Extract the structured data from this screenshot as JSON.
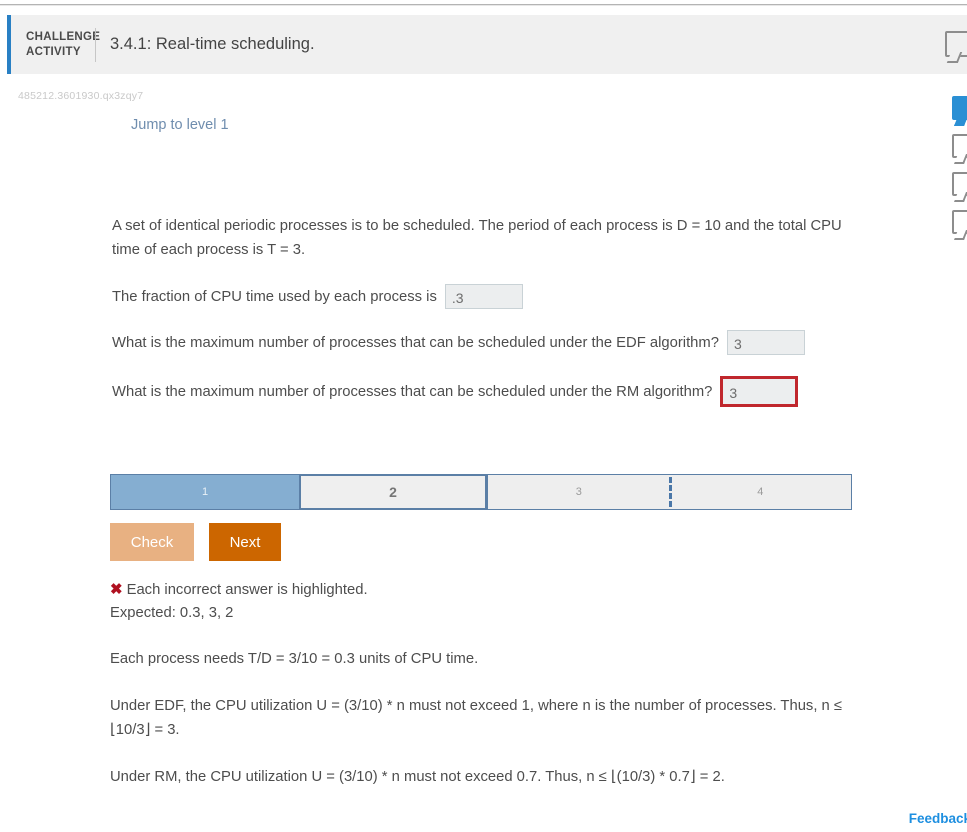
{
  "header": {
    "kicker_line1": "CHALLENGE",
    "kicker_line2": "ACTIVITY",
    "title": "3.4.1: Real-time scheduling.",
    "note_icon": "note-icon"
  },
  "activity_id": "485212.3601930.qx3zqy7",
  "jump_link": "Jump to level 1",
  "question": {
    "prompt": "A set of identical periodic processes is to be scheduled. The period of each process is D = 10 and the total CPU time of each process is T = 3.",
    "sub1_label": "The fraction of CPU time used by each process is",
    "sub1_value": ".3",
    "sub2_label": "What is the maximum number of processes that can be scheduled under the EDF algorithm?",
    "sub2_value": "3",
    "sub3_label": "What is the maximum number of processes that can be scheduled under the RM algorithm?",
    "sub3_value": "3"
  },
  "progress": {
    "steps": [
      {
        "label": "1",
        "state": "done"
      },
      {
        "label": "2",
        "state": "current"
      },
      {
        "label": "3",
        "state": "plain"
      },
      {
        "label": "4",
        "state": "plain"
      }
    ]
  },
  "buttons": {
    "check": "Check",
    "next": "Next"
  },
  "result": {
    "mark": "✖",
    "message": "Each incorrect answer is highlighted.",
    "expected": "Expected: 0.3, 3, 2"
  },
  "explanation": {
    "p1": "Each process needs T/D = 3/10 = 0.3 units of CPU time.",
    "p2": "Under EDF, the CPU utilization U = (3/10) * n must not exceed 1, where n is the number of processes. Thus, n ≤ ⌊10/3⌋ = 3.",
    "p3": "Under RM, the CPU utilization U = (3/10) * n must not exceed 0.7. Thus, n ≤ ⌊(10/3) * 0.7⌋ = 2."
  },
  "feedback": "Feedback",
  "colors": {
    "header_accent": "#2980c4",
    "header_bg": "#f0f0f0",
    "step_done": "#85aed1",
    "step_border": "#5b7fa6",
    "check_button": "#e8b182",
    "next_button": "#cc6600",
    "error_border": "#c0272d",
    "error_mark": "#b01020",
    "feedback_link": "#1e8fe0",
    "jump_link": "#6f8dae"
  }
}
